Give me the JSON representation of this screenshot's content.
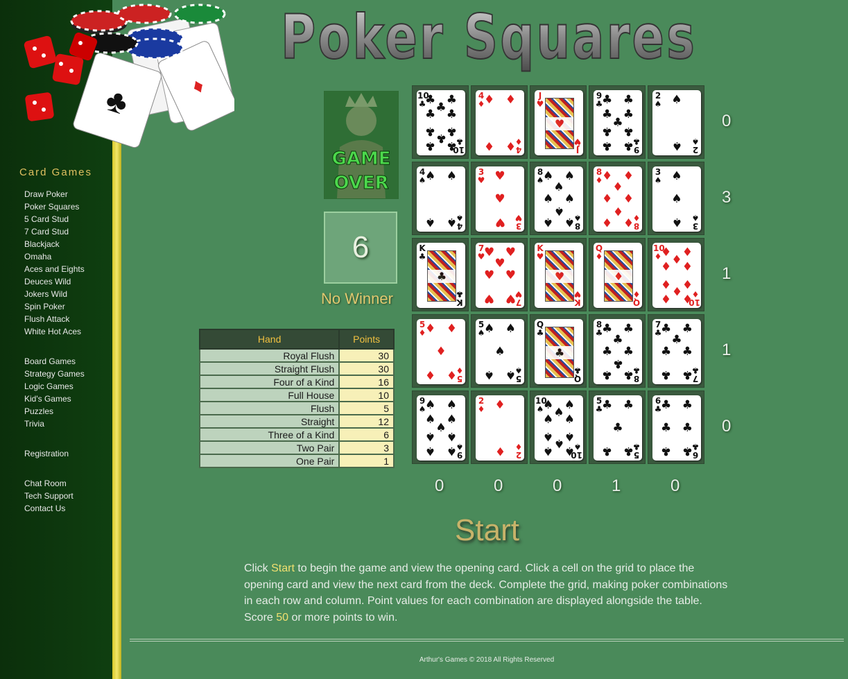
{
  "title": "Poker Squares",
  "sidebar": {
    "heading": "Card Games",
    "card_games": [
      "Draw Poker",
      "Poker Squares",
      "5 Card Stud",
      "7 Card Stud",
      "Blackjack",
      "Omaha",
      "Aces and Eights",
      "Deuces Wild",
      "Jokers Wild",
      "Spin Poker",
      "Flush Attack",
      "White Hot Aces"
    ],
    "other_games": [
      "Board Games",
      "Strategy Games",
      "Logic Games",
      "Kid's Games",
      "Puzzles",
      "Trivia"
    ],
    "account": [
      "Registration"
    ],
    "support": [
      "Chat Room",
      "Tech Support",
      "Contact Us"
    ]
  },
  "game_over_label": "GAME OVER",
  "score": "6",
  "status": "No Winner",
  "points_table": {
    "headers": [
      "Hand",
      "Points"
    ],
    "rows": [
      [
        "Royal Flush",
        "30"
      ],
      [
        "Straight Flush",
        "30"
      ],
      [
        "Four of a Kind",
        "16"
      ],
      [
        "Full House",
        "10"
      ],
      [
        "Flush",
        "5"
      ],
      [
        "Straight",
        "12"
      ],
      [
        "Three of a Kind",
        "6"
      ],
      [
        "Two Pair",
        "3"
      ],
      [
        "One Pair",
        "1"
      ]
    ]
  },
  "grid": [
    [
      {
        "rank": "10",
        "suit": "clubs"
      },
      {
        "rank": "4",
        "suit": "diamonds"
      },
      {
        "rank": "J",
        "suit": "hearts"
      },
      {
        "rank": "9",
        "suit": "clubs"
      },
      {
        "rank": "2",
        "suit": "spades"
      }
    ],
    [
      {
        "rank": "4",
        "suit": "spades"
      },
      {
        "rank": "3",
        "suit": "hearts"
      },
      {
        "rank": "8",
        "suit": "spades"
      },
      {
        "rank": "8",
        "suit": "diamonds"
      },
      {
        "rank": "3",
        "suit": "spades"
      }
    ],
    [
      {
        "rank": "K",
        "suit": "clubs"
      },
      {
        "rank": "7",
        "suit": "hearts"
      },
      {
        "rank": "K",
        "suit": "hearts"
      },
      {
        "rank": "Q",
        "suit": "diamonds"
      },
      {
        "rank": "10",
        "suit": "diamonds"
      }
    ],
    [
      {
        "rank": "5",
        "suit": "diamonds"
      },
      {
        "rank": "5",
        "suit": "spades"
      },
      {
        "rank": "Q",
        "suit": "clubs"
      },
      {
        "rank": "8",
        "suit": "clubs"
      },
      {
        "rank": "7",
        "suit": "clubs"
      }
    ],
    [
      {
        "rank": "9",
        "suit": "spades"
      },
      {
        "rank": "2",
        "suit": "diamonds"
      },
      {
        "rank": "10",
        "suit": "spades"
      },
      {
        "rank": "5",
        "suit": "clubs"
      },
      {
        "rank": "6",
        "suit": "clubs"
      }
    ]
  ],
  "row_scores": [
    "0",
    "3",
    "1",
    "1",
    "0"
  ],
  "col_scores": [
    "0",
    "0",
    "0",
    "1",
    "0"
  ],
  "start_label": "Start",
  "instructions": {
    "part1": "Click ",
    "start_word": "Start",
    "part2": " to begin the game and view the opening card. Click a cell on the grid to place the opening card and view the next card from the deck. Complete the grid, making poker combinations in each row and column. Point values for each combination are displayed alongside the table. Score ",
    "target": "50",
    "part3": " or more points to win."
  },
  "footer": "Arthur's Games © 2018 All Rights Reserved",
  "colors": {
    "background": "#4a8a5a",
    "sidebar": "#0f3f10",
    "accent_yellow": "#f0e070",
    "heading_gold": "#e0c060"
  }
}
